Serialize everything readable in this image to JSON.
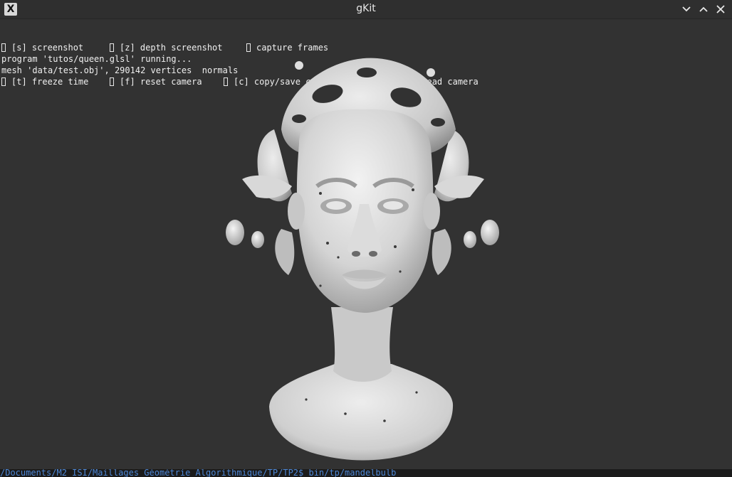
{
  "window": {
    "title": "gKit",
    "app_icon_glyph": "X",
    "controls": [
      "chevron-down-icon",
      "chevron-up-icon",
      "close-icon"
    ]
  },
  "hud": {
    "row1": [
      {
        "label": "[s] screenshot"
      },
      {
        "label": "[z] depth screenshot"
      },
      {
        "label": "capture frames"
      }
    ],
    "row2": [
      {
        "label": "[t] freeze time"
      },
      {
        "label": "[f] reset camera"
      },
      {
        "label": "[c] copy/save camera"
      },
      {
        "label": "[v] paste/read camera"
      }
    ],
    "status_program": "program 'tutos/queen.glsl' running...",
    "status_mesh": "mesh 'data/test.obj', 290142 vertices  normals"
  },
  "terminal": {
    "text": "/Documents/M2 ISI/Maillages Géométrie Algorithmique/TP/TP2$ bin/tp/mandelbulb"
  },
  "colors": {
    "background": "#323232",
    "titlebar": "#2f2f2f",
    "text": "#f0f0f0",
    "terminal_prompt": "#4d87d6"
  }
}
